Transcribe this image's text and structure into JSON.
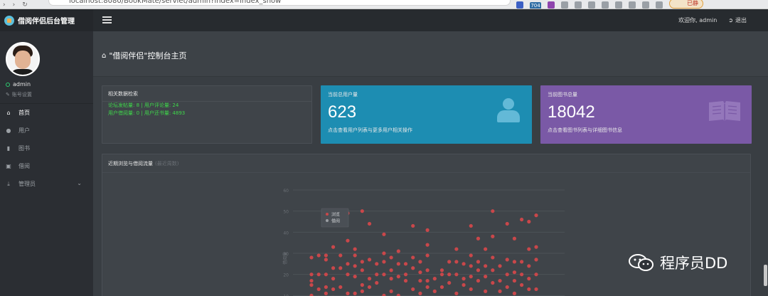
{
  "browser": {
    "url": "localhost:8080/BookMate/servlet/admin?index=index_show",
    "ext_badge": "704",
    "ext_pill": "已静"
  },
  "header": {
    "brand": "借阅伴侣后台管理",
    "welcome": "欢迎你, admin",
    "logout": "退出"
  },
  "sidebar": {
    "username": "admin",
    "settings": "账号设置",
    "items": [
      {
        "label": "首页",
        "icon": "home-icon"
      },
      {
        "label": "用户",
        "icon": "user-icon"
      },
      {
        "label": "图书",
        "icon": "book-icon"
      },
      {
        "label": "借阅",
        "icon": "calendar-icon"
      },
      {
        "label": "管理员",
        "icon": "download-icon"
      }
    ]
  },
  "page": {
    "title": "\"借阅伴侣\"控制台主页"
  },
  "stats_panel": {
    "title": "相关数据检索",
    "line1": "论坛发帖量: 8 | 用户评论量: 24",
    "line2": "用户借阅量: 0 | 用户还书量: 4893"
  },
  "users_card": {
    "label": "当前总用户量",
    "value": "623",
    "sub": "点击查看用户列表与更多用户相关操作",
    "color": "#1d8db2"
  },
  "books_card": {
    "label": "当前图书总量",
    "value": "18042",
    "sub": "点击查看图书列表与详细图书信息",
    "color": "#7a59a6"
  },
  "chart_panel": {
    "title": "近期浏览与借阅流量",
    "subtitle": "(最近周数)"
  },
  "chart_data": {
    "type": "scatter",
    "title": "近期浏览与借阅流量",
    "ylabel": "借阅量",
    "ylim": [
      0,
      60
    ],
    "yticks": [
      10,
      20,
      30,
      40,
      50,
      60
    ],
    "legend": [
      "浏览",
      "借阅"
    ],
    "legend_position": "top-left",
    "series": [
      {
        "name": "浏览",
        "color": "#c9474a",
        "points": [
          [
            0,
            28
          ],
          [
            0,
            20
          ],
          [
            0,
            17
          ],
          [
            0,
            15
          ],
          [
            0,
            10
          ],
          [
            1,
            29
          ],
          [
            1,
            20
          ],
          [
            1,
            13
          ],
          [
            1,
            9
          ],
          [
            2,
            29
          ],
          [
            2,
            27
          ],
          [
            2,
            20
          ],
          [
            2,
            14
          ],
          [
            2,
            11
          ],
          [
            3,
            33
          ],
          [
            3,
            23
          ],
          [
            3,
            18
          ],
          [
            3,
            13
          ],
          [
            3,
            9
          ],
          [
            4,
            29
          ],
          [
            4,
            23
          ],
          [
            4,
            14
          ],
          [
            5,
            49
          ],
          [
            5,
            36
          ],
          [
            5,
            25
          ],
          [
            5,
            20
          ],
          [
            5,
            11
          ],
          [
            6,
            32
          ],
          [
            6,
            29
          ],
          [
            6,
            24
          ],
          [
            6,
            19
          ],
          [
            6,
            11
          ],
          [
            7,
            50
          ],
          [
            7,
            26
          ],
          [
            7,
            22
          ],
          [
            7,
            15
          ],
          [
            7,
            12
          ],
          [
            8,
            44
          ],
          [
            8,
            27
          ],
          [
            8,
            18
          ],
          [
            8,
            14
          ],
          [
            9,
            25
          ],
          [
            9,
            20
          ],
          [
            9,
            16
          ],
          [
            10,
            39
          ],
          [
            10,
            30
          ],
          [
            10,
            26
          ],
          [
            10,
            20
          ],
          [
            10,
            10
          ],
          [
            11,
            28
          ],
          [
            11,
            22
          ],
          [
            11,
            18
          ],
          [
            11,
            12
          ],
          [
            12,
            31
          ],
          [
            12,
            25
          ],
          [
            12,
            19
          ],
          [
            12,
            10
          ],
          [
            13,
            25
          ],
          [
            13,
            20
          ],
          [
            13,
            17
          ],
          [
            14,
            43
          ],
          [
            14,
            28
          ],
          [
            14,
            23
          ],
          [
            14,
            13
          ],
          [
            15,
            26
          ],
          [
            15,
            21
          ],
          [
            15,
            17
          ],
          [
            15,
            11
          ],
          [
            16,
            41
          ],
          [
            16,
            34
          ],
          [
            16,
            29
          ],
          [
            16,
            22
          ],
          [
            16,
            17
          ],
          [
            16,
            14
          ],
          [
            17,
            18
          ],
          [
            17,
            12
          ],
          [
            18,
            22
          ],
          [
            18,
            20
          ],
          [
            18,
            14
          ],
          [
            19,
            26
          ],
          [
            19,
            20
          ],
          [
            19,
            16
          ],
          [
            20,
            32
          ],
          [
            20,
            26
          ],
          [
            20,
            20
          ],
          [
            20,
            11
          ],
          [
            21,
            25
          ],
          [
            21,
            18
          ],
          [
            21,
            15
          ],
          [
            22,
            43
          ],
          [
            22,
            29
          ],
          [
            22,
            24
          ],
          [
            22,
            19
          ],
          [
            22,
            13
          ],
          [
            23,
            37
          ],
          [
            23,
            26
          ],
          [
            23,
            22
          ],
          [
            23,
            17
          ],
          [
            24,
            32
          ],
          [
            24,
            24
          ],
          [
            24,
            19
          ],
          [
            24,
            12
          ],
          [
            25,
            50
          ],
          [
            25,
            38
          ],
          [
            25,
            28
          ],
          [
            25,
            22
          ],
          [
            25,
            16
          ],
          [
            26,
            24
          ],
          [
            26,
            17
          ],
          [
            26,
            12
          ],
          [
            27,
            44
          ],
          [
            27,
            27
          ],
          [
            27,
            20
          ],
          [
            27,
            14
          ],
          [
            28,
            37
          ],
          [
            28,
            26
          ],
          [
            28,
            21
          ],
          [
            28,
            17
          ],
          [
            28,
            11
          ],
          [
            29,
            46
          ],
          [
            29,
            26
          ],
          [
            29,
            20
          ],
          [
            29,
            15
          ],
          [
            30,
            45
          ],
          [
            30,
            32
          ],
          [
            30,
            24
          ],
          [
            30,
            18
          ],
          [
            30,
            13
          ],
          [
            31,
            48
          ],
          [
            31,
            33
          ],
          [
            31,
            27
          ],
          [
            31,
            20
          ],
          [
            31,
            13
          ]
        ]
      },
      {
        "name": "借阅",
        "color": "#9a9ea3",
        "points": []
      }
    ]
  }
}
